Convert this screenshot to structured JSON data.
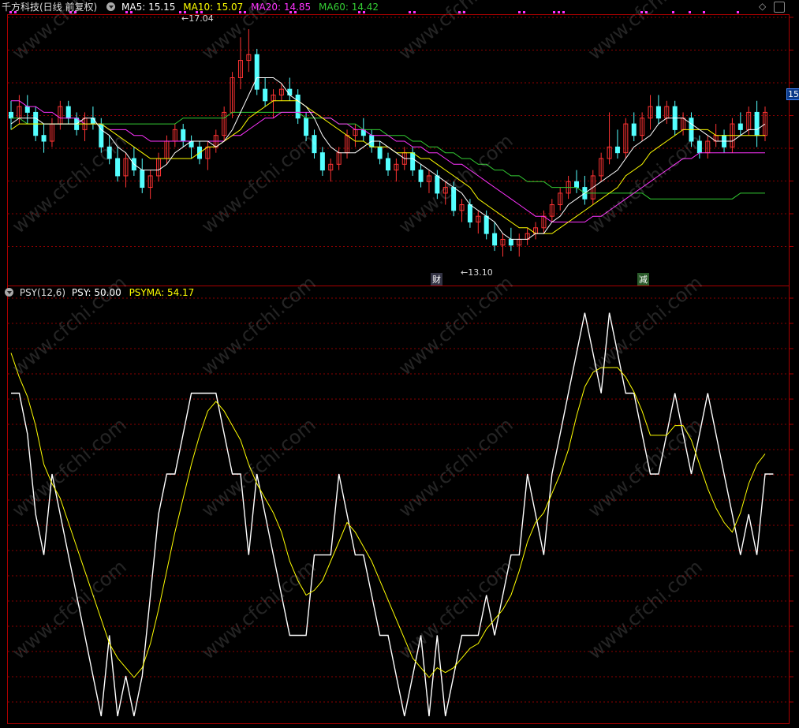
{
  "main_panel": {
    "title": "千方科技(日线 前复权)",
    "ma5_label": "MA5: 15.15",
    "ma10_label": "MA10: 15.07",
    "ma20_label": "MA20: 14.85",
    "ma60_label": "MA60: 14.42",
    "high_label": "17.04",
    "low_label": "13.10",
    "price_tag": "15.",
    "event_markers": [
      "财",
      "减"
    ],
    "watermark": "www.cfchi.com"
  },
  "sub_panel": {
    "title": "PSY(12,6)",
    "psy_label": "PSY: 50.00",
    "psyma_label": "PSYMA: 54.17"
  },
  "colors": {
    "up": "#ff3333",
    "down": "#54ffff",
    "ma5": "#ffffff",
    "ma10": "#ffff00",
    "ma20": "#ff33ff",
    "ma60": "#33cc33",
    "psy": "#ffffff",
    "psyma": "#ffff00",
    "grid": "#8b0000"
  },
  "chart_data": [
    {
      "type": "candlestick",
      "ylim": [
        12.6,
        17.3
      ],
      "ohlc": [
        [
          15.6,
          15.8,
          15.3,
          15.5
        ],
        [
          15.5,
          15.9,
          15.4,
          15.7
        ],
        [
          15.7,
          15.9,
          15.4,
          15.6
        ],
        [
          15.6,
          15.7,
          15.1,
          15.2
        ],
        [
          15.2,
          15.4,
          14.9,
          15.1
        ],
        [
          15.1,
          15.5,
          15.0,
          15.4
        ],
        [
          15.4,
          15.8,
          15.3,
          15.7
        ],
        [
          15.7,
          15.8,
          15.4,
          15.5
        ],
        [
          15.5,
          15.6,
          15.2,
          15.3
        ],
        [
          15.3,
          15.6,
          15.1,
          15.5
        ],
        [
          15.5,
          15.7,
          15.3,
          15.4
        ],
        [
          15.4,
          15.5,
          14.9,
          15.0
        ],
        [
          15.0,
          15.2,
          14.7,
          14.8
        ],
        [
          14.8,
          15.0,
          14.4,
          14.5
        ],
        [
          14.5,
          14.9,
          14.3,
          14.8
        ],
        [
          14.8,
          15.0,
          14.5,
          14.6
        ],
        [
          14.6,
          14.8,
          14.2,
          14.3
        ],
        [
          14.3,
          14.6,
          14.1,
          14.5
        ],
        [
          14.5,
          14.9,
          14.4,
          14.8
        ],
        [
          14.8,
          15.2,
          14.7,
          15.1
        ],
        [
          15.1,
          15.4,
          15.0,
          15.3
        ],
        [
          15.3,
          15.4,
          15.0,
          15.1
        ],
        [
          15.1,
          15.2,
          14.8,
          15.0
        ],
        [
          15.0,
          15.1,
          14.7,
          14.8
        ],
        [
          14.8,
          15.1,
          14.6,
          15.0
        ],
        [
          15.0,
          15.3,
          14.9,
          15.2
        ],
        [
          15.2,
          15.7,
          15.1,
          15.6
        ],
        [
          15.6,
          16.3,
          15.5,
          16.2
        ],
        [
          16.2,
          16.9,
          16.0,
          16.5
        ],
        [
          16.5,
          17.04,
          16.3,
          16.6
        ],
        [
          16.6,
          16.7,
          15.9,
          16.0
        ],
        [
          16.0,
          16.2,
          15.7,
          15.8
        ],
        [
          15.8,
          16.0,
          15.5,
          15.9
        ],
        [
          15.9,
          16.1,
          15.8,
          16.0
        ],
        [
          16.0,
          16.2,
          15.8,
          15.9
        ],
        [
          15.9,
          16.0,
          15.4,
          15.5
        ],
        [
          15.5,
          15.6,
          15.1,
          15.2
        ],
        [
          15.2,
          15.3,
          14.8,
          14.9
        ],
        [
          14.9,
          15.0,
          14.5,
          14.6
        ],
        [
          14.6,
          14.8,
          14.4,
          14.7
        ],
        [
          14.7,
          15.0,
          14.6,
          14.9
        ],
        [
          14.9,
          15.3,
          14.8,
          15.2
        ],
        [
          15.2,
          15.4,
          15.0,
          15.3
        ],
        [
          15.3,
          15.5,
          15.1,
          15.2
        ],
        [
          15.2,
          15.3,
          14.9,
          15.0
        ],
        [
          15.0,
          15.1,
          14.7,
          14.8
        ],
        [
          14.8,
          14.9,
          14.5,
          14.6
        ],
        [
          14.6,
          14.8,
          14.4,
          14.7
        ],
        [
          14.7,
          15.0,
          14.6,
          14.9
        ],
        [
          14.9,
          15.0,
          14.5,
          14.6
        ],
        [
          14.6,
          14.7,
          14.3,
          14.4
        ],
        [
          14.4,
          14.6,
          14.2,
          14.5
        ],
        [
          14.5,
          14.6,
          14.1,
          14.2
        ],
        [
          14.2,
          14.4,
          14.0,
          14.3
        ],
        [
          14.3,
          14.4,
          13.8,
          13.9
        ],
        [
          13.9,
          14.1,
          13.7,
          14.0
        ],
        [
          14.0,
          14.1,
          13.6,
          13.7
        ],
        [
          13.7,
          13.9,
          13.5,
          13.8
        ],
        [
          13.8,
          13.9,
          13.4,
          13.5
        ],
        [
          13.5,
          13.7,
          13.2,
          13.3
        ],
        [
          13.3,
          13.5,
          13.1,
          13.4
        ],
        [
          13.4,
          13.6,
          13.2,
          13.3
        ],
        [
          13.3,
          13.5,
          13.1,
          13.4
        ],
        [
          13.4,
          13.6,
          13.3,
          13.5
        ],
        [
          13.5,
          13.7,
          13.4,
          13.6
        ],
        [
          13.6,
          13.9,
          13.5,
          13.8
        ],
        [
          13.8,
          14.1,
          13.7,
          14.0
        ],
        [
          14.0,
          14.3,
          13.9,
          14.2
        ],
        [
          14.2,
          14.5,
          14.1,
          14.4
        ],
        [
          14.4,
          14.6,
          14.2,
          14.3
        ],
        [
          14.3,
          14.5,
          14.0,
          14.1
        ],
        [
          14.1,
          14.6,
          14.0,
          14.5
        ],
        [
          14.5,
          14.9,
          14.4,
          14.8
        ],
        [
          14.8,
          15.6,
          14.7,
          15.0
        ],
        [
          15.0,
          15.3,
          14.8,
          14.9
        ],
        [
          14.9,
          15.5,
          14.8,
          15.4
        ],
        [
          15.4,
          15.6,
          15.1,
          15.2
        ],
        [
          15.2,
          15.6,
          15.1,
          15.5
        ],
        [
          15.5,
          15.9,
          15.3,
          15.7
        ],
        [
          15.7,
          15.9,
          15.4,
          15.5
        ],
        [
          15.5,
          15.8,
          15.4,
          15.7
        ],
        [
          15.7,
          15.8,
          15.2,
          15.3
        ],
        [
          15.3,
          15.6,
          15.2,
          15.5
        ],
        [
          15.5,
          15.6,
          15.0,
          15.1
        ],
        [
          15.1,
          15.2,
          14.8,
          14.9
        ],
        [
          14.9,
          15.2,
          14.8,
          15.1
        ],
        [
          15.1,
          15.4,
          15.0,
          15.2
        ],
        [
          15.2,
          15.3,
          14.9,
          15.0
        ],
        [
          15.0,
          15.5,
          14.9,
          15.4
        ],
        [
          15.4,
          15.6,
          15.2,
          15.3
        ],
        [
          15.3,
          15.7,
          15.2,
          15.6
        ],
        [
          15.6,
          15.8,
          15.0,
          15.2
        ],
        [
          15.2,
          15.7,
          15.1,
          15.6
        ]
      ],
      "ma5": [
        15.4,
        15.5,
        15.5,
        15.5,
        15.4,
        15.4,
        15.4,
        15.4,
        15.4,
        15.5,
        15.5,
        15.3,
        15.2,
        15.0,
        14.9,
        14.7,
        14.6,
        14.6,
        14.6,
        14.7,
        14.9,
        15.0,
        15.1,
        15.1,
        15.1,
        15.0,
        15.1,
        15.3,
        15.6,
        15.9,
        16.2,
        16.2,
        16.2,
        16.1,
        15.9,
        15.8,
        15.7,
        15.5,
        15.2,
        15.0,
        14.9,
        14.9,
        14.9,
        15.0,
        15.1,
        15.1,
        15.0,
        14.9,
        14.8,
        14.8,
        14.7,
        14.6,
        14.5,
        14.4,
        14.3,
        14.2,
        14.0,
        13.9,
        13.8,
        13.7,
        13.5,
        13.4,
        13.4,
        13.4,
        13.5,
        13.5,
        13.7,
        13.8,
        14.0,
        14.1,
        14.2,
        14.3,
        14.4,
        14.5,
        14.6,
        14.8,
        15.0,
        15.1,
        15.2,
        15.4,
        15.5,
        15.5,
        15.5,
        15.4,
        15.3,
        15.2,
        15.1,
        15.1,
        15.1,
        15.2,
        15.3,
        15.3,
        15.4
      ],
      "ma10": [
        15.3,
        15.4,
        15.4,
        15.4,
        15.4,
        15.4,
        15.4,
        15.4,
        15.4,
        15.4,
        15.4,
        15.4,
        15.3,
        15.2,
        15.1,
        15.0,
        14.9,
        14.8,
        14.8,
        14.8,
        14.8,
        14.8,
        14.8,
        14.9,
        15.0,
        15.0,
        15.1,
        15.2,
        15.3,
        15.5,
        15.6,
        15.7,
        15.8,
        15.8,
        15.8,
        15.8,
        15.7,
        15.6,
        15.5,
        15.4,
        15.3,
        15.2,
        15.1,
        15.1,
        15.0,
        15.0,
        15.0,
        14.9,
        14.9,
        14.9,
        14.8,
        14.8,
        14.7,
        14.6,
        14.5,
        14.4,
        14.3,
        14.1,
        14.0,
        13.9,
        13.8,
        13.7,
        13.6,
        13.6,
        13.5,
        13.5,
        13.5,
        13.6,
        13.7,
        13.8,
        13.9,
        14.0,
        14.1,
        14.2,
        14.3,
        14.5,
        14.6,
        14.7,
        14.9,
        15.0,
        15.1,
        15.2,
        15.3,
        15.3,
        15.3,
        15.3,
        15.2,
        15.2,
        15.2,
        15.2,
        15.2,
        15.2,
        15.2
      ],
      "ma20": [
        15.8,
        15.8,
        15.7,
        15.7,
        15.6,
        15.6,
        15.5,
        15.5,
        15.5,
        15.4,
        15.4,
        15.4,
        15.3,
        15.3,
        15.3,
        15.2,
        15.2,
        15.1,
        15.1,
        15.1,
        15.1,
        15.1,
        15.1,
        15.1,
        15.1,
        15.1,
        15.1,
        15.2,
        15.2,
        15.3,
        15.4,
        15.5,
        15.5,
        15.6,
        15.6,
        15.6,
        15.6,
        15.6,
        15.5,
        15.5,
        15.4,
        15.4,
        15.3,
        15.3,
        15.2,
        15.2,
        15.2,
        15.1,
        15.1,
        15.0,
        15.0,
        14.9,
        14.9,
        14.8,
        14.7,
        14.7,
        14.6,
        14.5,
        14.4,
        14.3,
        14.2,
        14.1,
        14.0,
        13.9,
        13.8,
        13.8,
        13.7,
        13.7,
        13.7,
        13.7,
        13.7,
        13.8,
        13.8,
        13.9,
        14.0,
        14.1,
        14.2,
        14.3,
        14.4,
        14.5,
        14.6,
        14.7,
        14.8,
        14.8,
        14.9,
        14.9,
        14.9,
        14.9,
        14.9,
        14.9,
        14.9,
        14.9,
        14.9
      ],
      "ma60": [
        15.5,
        15.5,
        15.4,
        15.4,
        15.4,
        15.4,
        15.4,
        15.4,
        15.4,
        15.4,
        15.4,
        15.4,
        15.4,
        15.4,
        15.4,
        15.4,
        15.4,
        15.4,
        15.4,
        15.4,
        15.4,
        15.5,
        15.5,
        15.5,
        15.5,
        15.5,
        15.5,
        15.6,
        15.6,
        15.6,
        15.6,
        15.6,
        15.6,
        15.6,
        15.6,
        15.6,
        15.5,
        15.5,
        15.5,
        15.5,
        15.4,
        15.4,
        15.4,
        15.3,
        15.3,
        15.3,
        15.2,
        15.2,
        15.2,
        15.1,
        15.1,
        15.0,
        15.0,
        14.9,
        14.9,
        14.8,
        14.8,
        14.7,
        14.7,
        14.6,
        14.6,
        14.5,
        14.5,
        14.4,
        14.4,
        14.4,
        14.3,
        14.3,
        14.3,
        14.3,
        14.2,
        14.2,
        14.2,
        14.2,
        14.2,
        14.2,
        14.2,
        14.2,
        14.1,
        14.1,
        14.1,
        14.1,
        14.1,
        14.1,
        14.1,
        14.1,
        14.1,
        14.1,
        14.1,
        14.2,
        14.2,
        14.2,
        14.2
      ]
    },
    {
      "type": "line",
      "ylim": [
        0,
        86
      ],
      "series": [
        {
          "name": "PSY",
          "values": [
            66.7,
            66.7,
            58.3,
            41.7,
            33.3,
            50.0,
            41.7,
            33.3,
            25.0,
            16.7,
            8.3,
            0,
            16.7,
            0,
            8.3,
            0,
            8.3,
            25.0,
            41.7,
            50.0,
            50.0,
            58.3,
            66.7,
            66.7,
            66.7,
            66.7,
            58.3,
            50.0,
            50.0,
            33.3,
            50.0,
            41.7,
            33.3,
            25.0,
            16.7,
            16.7,
            16.7,
            33.3,
            33.3,
            33.3,
            50.0,
            41.7,
            33.3,
            33.3,
            25.0,
            16.7,
            16.7,
            8.3,
            0,
            8.3,
            16.7,
            0,
            16.7,
            0,
            8.3,
            16.7,
            16.7,
            16.7,
            25.0,
            16.7,
            25.0,
            33.3,
            33.3,
            50.0,
            41.7,
            33.3,
            50.0,
            58.3,
            66.7,
            75.0,
            83.3,
            75.0,
            66.7,
            83.3,
            75.0,
            66.7,
            66.7,
            58.3,
            50.0,
            50.0,
            58.3,
            66.7,
            58.3,
            50.0,
            58.3,
            66.7,
            58.3,
            50.0,
            41.7,
            33.3,
            41.7,
            33.3,
            50.0,
            50.0
          ]
        },
        {
          "name": "PSYMA",
          "values": [
            75.0,
            70.0,
            66.0,
            60.0,
            52.0,
            48.0,
            45.0,
            40.0,
            35.0,
            30.0,
            25.0,
            20.0,
            15.0,
            12.0,
            10.0,
            8.0,
            10.0,
            15.0,
            22.0,
            30.0,
            38.0,
            45.0,
            52.0,
            58.0,
            63.0,
            65.0,
            63.0,
            60.0,
            57.0,
            52.0,
            48.0,
            45.0,
            42.0,
            38.0,
            32.0,
            28.0,
            25.0,
            26.0,
            28.0,
            32.0,
            36.0,
            40.0,
            38.0,
            35.0,
            32.0,
            28.0,
            24.0,
            20.0,
            16.0,
            12.0,
            10.0,
            8.0,
            10.0,
            9.0,
            10.0,
            12.0,
            14.0,
            15.0,
            18.0,
            20.0,
            22.0,
            25.0,
            30.0,
            36.0,
            40.0,
            42.0,
            46.0,
            50.0,
            55.0,
            62.0,
            68.0,
            71.0,
            72.0,
            72.0,
            72.0,
            70.0,
            67.0,
            63.0,
            58.0,
            58.0,
            58.0,
            60.0,
            60.0,
            57.0,
            52.0,
            47.0,
            43.0,
            40.0,
            38.0,
            42.0,
            48.0,
            52.0,
            54.17
          ]
        }
      ]
    }
  ]
}
